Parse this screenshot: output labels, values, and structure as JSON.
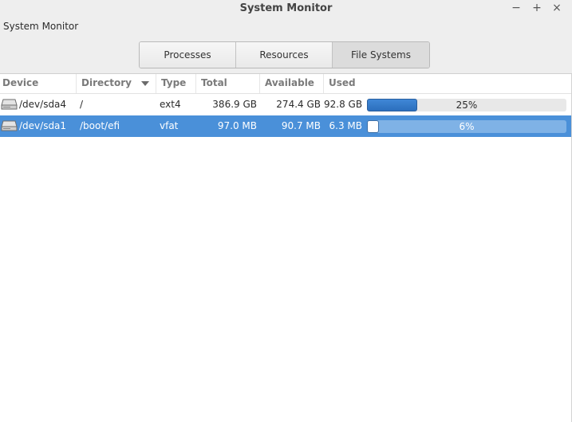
{
  "window": {
    "title": "System Monitor",
    "controls": {
      "minimize": "−",
      "maximize": "+",
      "close": "×"
    }
  },
  "menubar": {
    "items": [
      "System Monitor"
    ]
  },
  "tabs": [
    {
      "label": "Processes",
      "active": false
    },
    {
      "label": "Resources",
      "active": false
    },
    {
      "label": "File Systems",
      "active": true
    }
  ],
  "table": {
    "columns": [
      "Device",
      "Directory",
      "Type",
      "Total",
      "Available",
      "Used"
    ],
    "sorted_column": "Directory",
    "rows": [
      {
        "device": "/dev/sda4",
        "directory": "/",
        "type": "ext4",
        "total": "386.9 GB",
        "available": "274.4 GB",
        "used": "92.8 GB",
        "percent_label": "25%",
        "percent": 25,
        "selected": false,
        "icon": "drive-icon"
      },
      {
        "device": "/dev/sda1",
        "directory": "/boot/efi",
        "type": "vfat",
        "total": "97.0 MB",
        "available": "90.7 MB",
        "used": "6.3 MB",
        "percent_label": "6%",
        "percent": 6,
        "selected": true,
        "icon": "drive-icon"
      }
    ]
  },
  "colors": {
    "selection": "#4a90d9",
    "progress_fill": "#2c6fbd"
  }
}
